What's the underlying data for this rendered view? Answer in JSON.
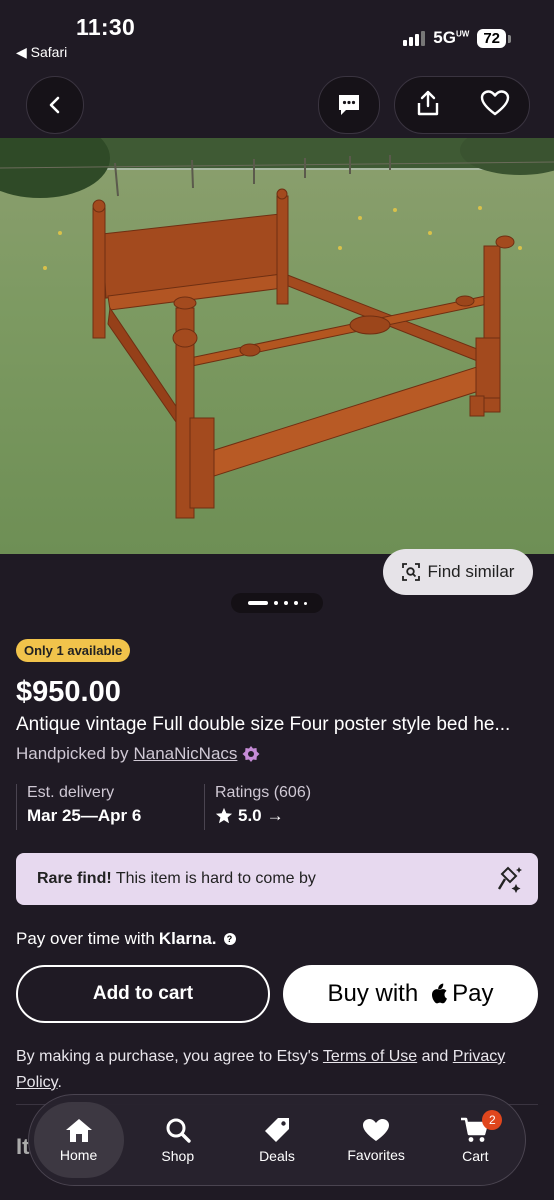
{
  "status": {
    "time": "11:30",
    "back_app": "Safari",
    "network": "5G",
    "network_sub": "UW",
    "battery": "72"
  },
  "image": {
    "find_similar": "Find similar"
  },
  "listing": {
    "availability": "Only 1 available",
    "price": "$950.00",
    "title": "Antique vintage Full double size Four poster style bed he...",
    "handpicked_prefix": "Handpicked by",
    "shop_name": "NanaNicNacs"
  },
  "delivery": {
    "label": "Est. delivery",
    "value": "Mar 25—Apr 6"
  },
  "ratings": {
    "label": "Ratings (606)",
    "value": "5.0"
  },
  "rare": {
    "bold": "Rare find!",
    "text": "This item is hard to come by"
  },
  "klarna": {
    "text": "Pay over time with",
    "brand": "Klarna."
  },
  "buttons": {
    "add_to_cart": "Add to cart",
    "buy_with": "Buy with",
    "apple_pay": "Pay"
  },
  "terms": {
    "prefix": "By making a purchase, you agree to Etsy's",
    "terms_link": "Terms of Use",
    "and": "and",
    "privacy_link": "Privacy Policy",
    "end": "."
  },
  "peek": "It",
  "tabs": [
    {
      "label": "Home",
      "icon": "home-icon"
    },
    {
      "label": "Shop",
      "icon": "search-icon"
    },
    {
      "label": "Deals",
      "icon": "tag-icon"
    },
    {
      "label": "Favorites",
      "icon": "heart-icon"
    },
    {
      "label": "Cart",
      "icon": "cart-icon"
    }
  ],
  "cart_count": "2"
}
